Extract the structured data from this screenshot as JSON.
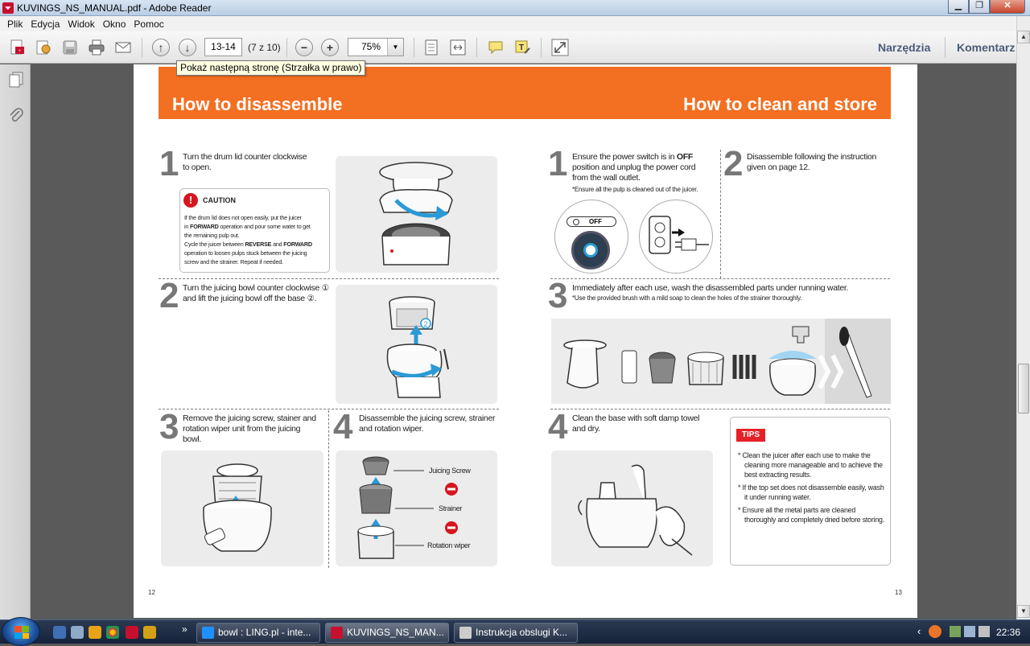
{
  "window": {
    "title": "KUVINGS_NS_MANUAL.pdf - Adobe Reader",
    "controls": [
      "minimize",
      "maximize",
      "close"
    ]
  },
  "menu": {
    "items": [
      "Plik",
      "Edycja",
      "Widok",
      "Okno",
      "Pomoc"
    ]
  },
  "toolbar": {
    "page_value": "13-14",
    "page_of": "(7 z 10)",
    "zoom_value": "75%",
    "tools_label": "Narzędzia",
    "comment_label": "Komentarz",
    "tooltip": "Pokaż następną stronę (Strzałka w prawo)"
  },
  "document": {
    "banner_left": "How to disassemble",
    "banner_right": "How to clean and store",
    "left_page_number": "12",
    "right_page_number": "13",
    "disassemble": {
      "step1": {
        "num": "1",
        "line1": "Turn the drum lid counter clockwise",
        "line2": "to open."
      },
      "caution": {
        "title": "CAUTION",
        "line1": "If the drum lid does not open easily, put the juicer",
        "line2a": "in ",
        "line2b": "FORWARD",
        "line2c": " operation and pour some water to get",
        "line3": "the remaining pulp out.",
        "line4a": "Cycle the juicer between ",
        "line4b": "REVERSE",
        "line4c": " and ",
        "line4d": "FORWARD",
        "line5": "operation to loosen pulps stuck between the juicing",
        "line6": "screw and the strainer. Repeat if needed."
      },
      "step2": {
        "num": "2",
        "line1": "Turn the juicing bowl counter clockwise ①",
        "line2": "and lift the juicing bowl off the base ②."
      },
      "step3": {
        "num": "3",
        "line1": "Remove the juicing screw, stainer and",
        "line2": "rotation wiper unit from the juicing",
        "line3": "bowl."
      },
      "step4": {
        "num": "4",
        "line1": "Disassemble the juicing screw, strainer",
        "line2": "and rotation wiper.",
        "labels": [
          "Juicing Screw",
          "Strainer",
          "Rotation wiper"
        ]
      }
    },
    "clean": {
      "step1": {
        "num": "1",
        "line1a": "Ensure the power switch is in ",
        "line1b": "OFF",
        "line2": "position and unplug the power cord",
        "line3": "from the wall outlet.",
        "note": "*Ensure all the pulp is cleaned out of the juicer.",
        "switch_label": "OFF"
      },
      "step2": {
        "num": "2",
        "line1": "Disassemble following the instruction",
        "line2": "given on page 12."
      },
      "step3": {
        "num": "3",
        "line1": "Immediately after each use, wash the disassembled parts under running water.",
        "note": "*Use the provided brush with a mild soap to clean the holes of the strainer thoroughly."
      },
      "step4": {
        "num": "4",
        "line1": "Clean the base with soft damp towel",
        "line2": "and dry."
      },
      "tips": {
        "title": "TIPS",
        "items": [
          "* Clean the juicer after each use to  make the cleaning more manageable and to achieve the best extracting results.",
          "* If the top set does not disassemble easily, wash it under running water.",
          "* Ensure all the metal parts are cleaned thoroughly and completely dried before storing."
        ]
      }
    }
  },
  "taskbar": {
    "buttons": [
      "bowl : LING.pl - inte...",
      "KUVINGS_NS_MAN...",
      "Instrukcja obslugi K..."
    ],
    "overflow": "»",
    "tray_chevron": "‹",
    "clock": "22:36"
  },
  "colors": {
    "banner": "#f36f21",
    "accent_blue": "#2a9ad6",
    "caution_red": "#d7151d",
    "tips_red": "#e42127"
  },
  "icons": {
    "left_nav": [
      "pages-icon",
      "attachment-icon"
    ],
    "toolbar": [
      "create-pdf-icon",
      "edit-icon",
      "save-icon",
      "print-icon",
      "email-icon",
      "prev-page-icon",
      "next-page-icon",
      "zoom-out-icon",
      "zoom-in-icon",
      "fit-page-icon",
      "fit-width-icon",
      "comment-icon",
      "highlight-icon",
      "expand-icon"
    ]
  }
}
